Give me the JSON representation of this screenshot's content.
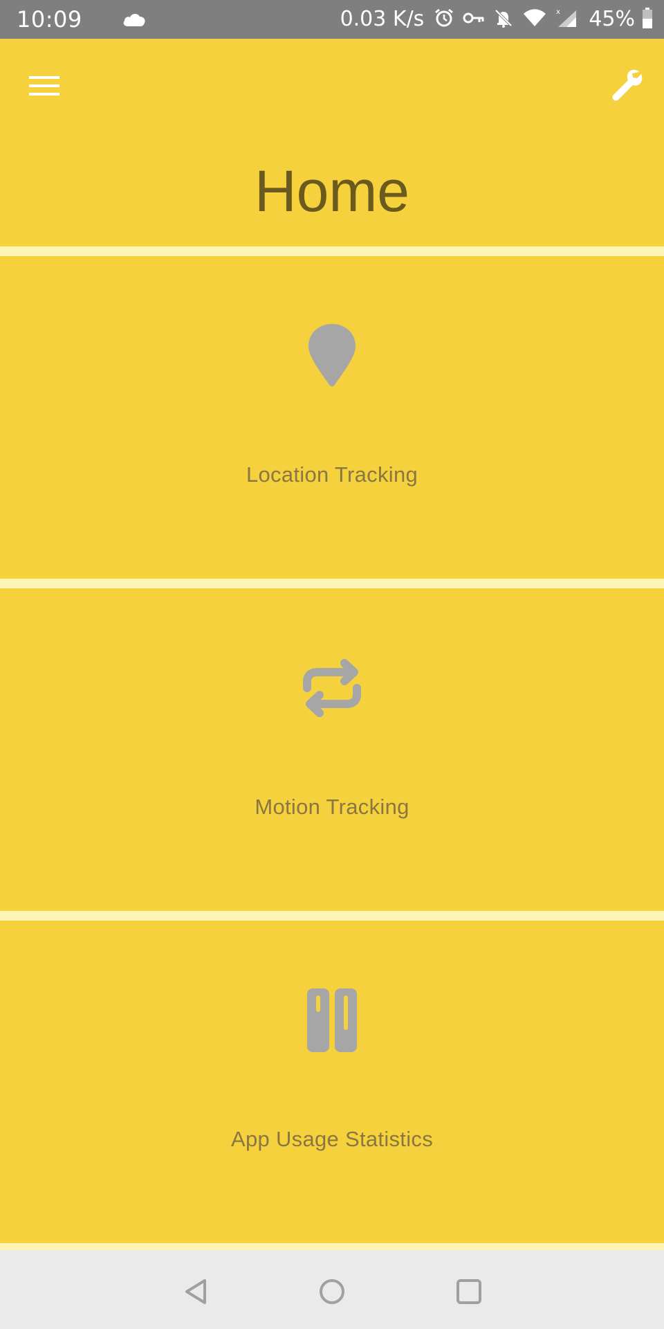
{
  "status_bar": {
    "time": "10:09",
    "net_speed": "0.03 K/s",
    "battery": "45%",
    "icons": [
      "cloud-icon",
      "alarm-icon",
      "vpn-key-icon",
      "bell-off-icon",
      "wifi-icon",
      "signal-icon",
      "battery-icon"
    ]
  },
  "header": {
    "title": "Home",
    "menu_icon": "hamburger-menu-icon",
    "settings_icon": "wrench-icon"
  },
  "cards": [
    {
      "label": "Location Tracking",
      "icon": "location-pin-icon"
    },
    {
      "label": "Motion Tracking",
      "icon": "repeat-arrows-icon"
    },
    {
      "label": "App Usage Statistics",
      "icon": "app-usage-icon"
    }
  ],
  "nav_bar": {
    "back": "back-triangle-icon",
    "home": "home-circle-icon",
    "recents": "recents-square-icon"
  },
  "colors": {
    "background": "#F5D23D",
    "divider": "#FFF3B5",
    "status_bar": "#7F7F7F",
    "icon_gray": "#A6A6A6",
    "title_text": "#6B5A1E",
    "label_text": "#8A7640",
    "nav_bar": "#EAEAEA"
  }
}
